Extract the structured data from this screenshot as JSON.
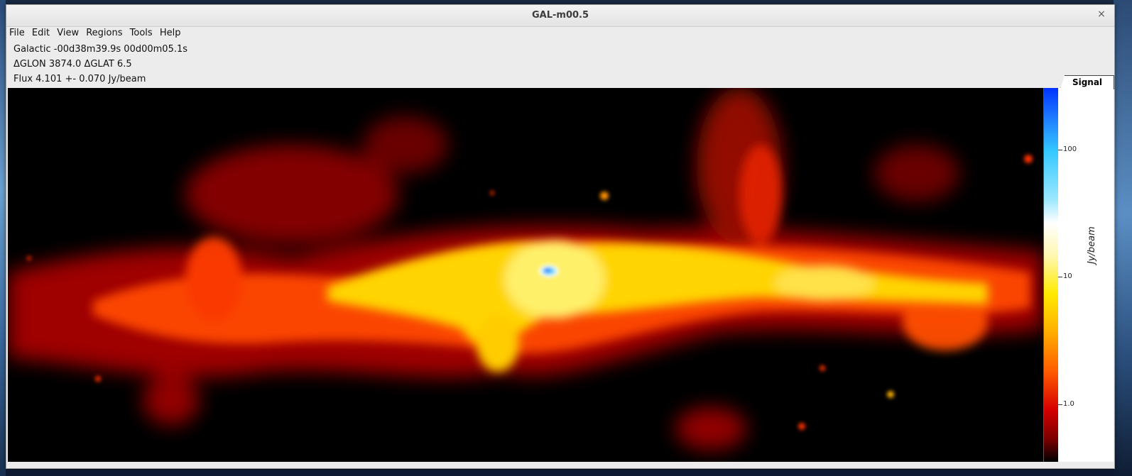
{
  "window": {
    "title": "GAL-m00.5",
    "close_glyph": "×"
  },
  "menu": [
    "File",
    "Edit",
    "View",
    "Regions",
    "Tools",
    "Help"
  ],
  "readout": {
    "coords": "Galactic -00d38m39.9s 00d00m05.1s",
    "delta": "ΔGLON 3874.0  ΔGLAT 6.5",
    "flux": "Flux 4.101 +- 0.070 Jy/beam"
  },
  "colorbar": {
    "tab_label": "Signal",
    "unit": "Jy/beam",
    "scale": "log",
    "ticks": [
      "100",
      "10",
      "1.0"
    ],
    "colors": [
      "#0033ff",
      "#34c8ff",
      "#ffffff",
      "#ffea00",
      "#ff5a00",
      "#d60000",
      "#000000"
    ]
  }
}
